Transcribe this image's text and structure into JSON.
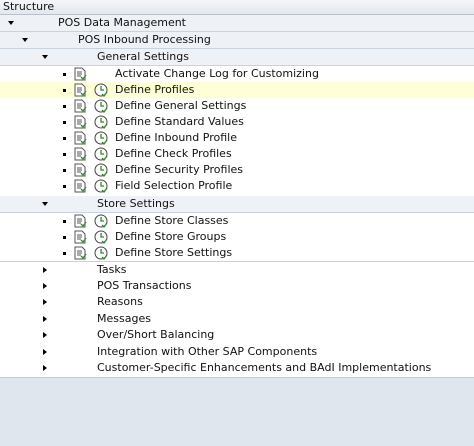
{
  "header": {
    "title": "Structure"
  },
  "rows": [
    {
      "label": "POS Data Management",
      "level": "root",
      "state": "expanded"
    },
    {
      "label": "POS Inbound Processing",
      "level": 1,
      "state": "expanded"
    },
    {
      "label": "General Settings",
      "level": 2,
      "state": "expanded"
    },
    {
      "label": "Activate Change Log for Customizing",
      "level": 3,
      "icons": [
        "document-icon"
      ]
    },
    {
      "label": "Define Profiles",
      "level": 3,
      "icons": [
        "document-icon",
        "clock-icon"
      ],
      "selected": true
    },
    {
      "label": "Define General Settings",
      "level": 3,
      "icons": [
        "document-icon",
        "clock-icon"
      ]
    },
    {
      "label": "Define Standard Values",
      "level": 3,
      "icons": [
        "document-icon",
        "clock-icon"
      ]
    },
    {
      "label": "Define Inbound Profile",
      "level": 3,
      "icons": [
        "document-icon",
        "clock-icon"
      ]
    },
    {
      "label": "Define Check Profiles",
      "level": 3,
      "icons": [
        "document-icon",
        "clock-icon"
      ]
    },
    {
      "label": "Define Security Profiles",
      "level": 3,
      "icons": [
        "document-icon",
        "clock-icon"
      ]
    },
    {
      "label": "Field Selection Profile",
      "level": 3,
      "icons": [
        "document-icon",
        "clock-icon"
      ]
    },
    {
      "label": "Store Settings",
      "level": 2,
      "state": "expanded"
    },
    {
      "label": "Define Store Classes",
      "level": 3,
      "icons": [
        "document-icon",
        "clock-icon"
      ]
    },
    {
      "label": "Define Store Groups",
      "level": 3,
      "icons": [
        "document-icon",
        "clock-icon"
      ]
    },
    {
      "label": "Define Store Settings",
      "level": 3,
      "icons": [
        "document-icon",
        "clock-icon"
      ]
    },
    {
      "label": "Tasks",
      "level": 1,
      "state": "collapsed"
    },
    {
      "label": "POS Transactions",
      "level": 1,
      "state": "collapsed"
    },
    {
      "label": "Reasons",
      "level": 1,
      "state": "collapsed"
    },
    {
      "label": "Messages",
      "level": 1,
      "state": "collapsed"
    },
    {
      "label": "Over/Short Balancing",
      "level": 1,
      "state": "collapsed"
    },
    {
      "label": "Integration with Other SAP Components",
      "level": 1,
      "state": "collapsed"
    },
    {
      "label": "Customer-Specific Enhancements and BAdI Implementations",
      "level": 1,
      "state": "collapsed"
    }
  ],
  "colors": {
    "selected_row": "#ffffd6",
    "node_row": "#eef2f6",
    "clock_green": "#2e8b2e"
  }
}
